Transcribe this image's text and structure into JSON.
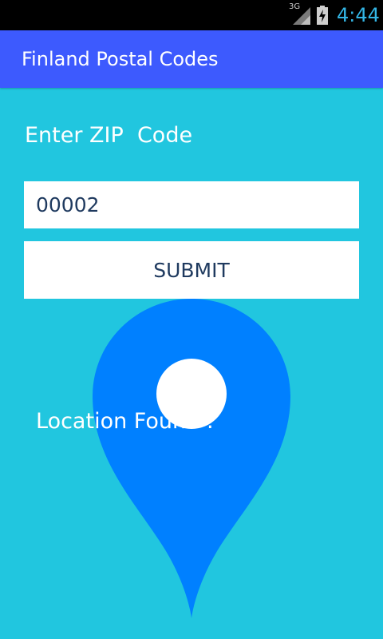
{
  "status_bar": {
    "network_type": "3G",
    "time": "4:44",
    "icons": [
      "signal-icon",
      "battery-charging-icon"
    ],
    "clock_color": "#33b5e5"
  },
  "app_bar": {
    "title": "Finland Postal Codes",
    "color": "#3d5afe"
  },
  "form": {
    "prompt_label": "Enter ZIP  Code",
    "zip_value": "00002",
    "submit_label": "SUBMIT"
  },
  "result": {
    "label": "Location Found :",
    "pin_icon": "location-pin-icon",
    "pin_color": "#0080ff"
  },
  "colors": {
    "background": "#21c6df",
    "text_dark": "#1f3a5f"
  }
}
